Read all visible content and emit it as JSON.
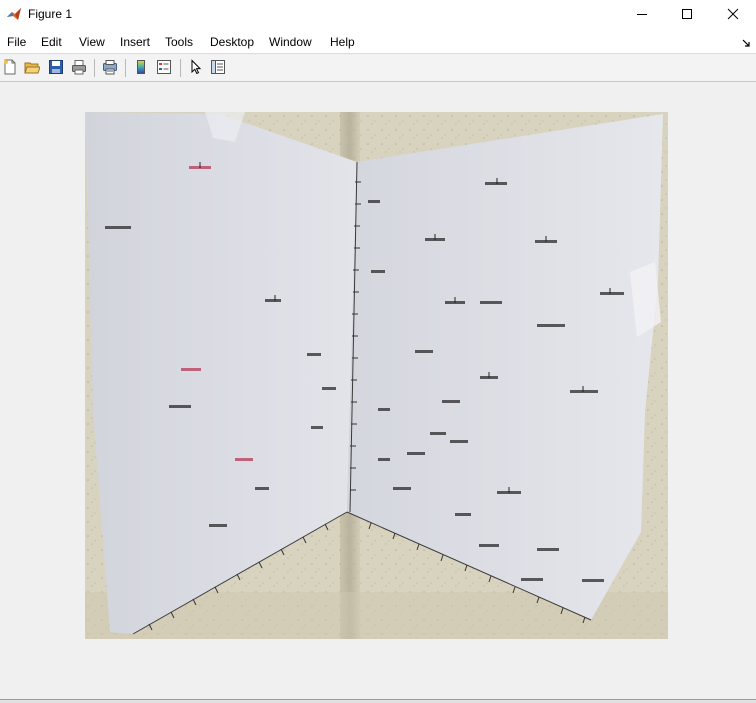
{
  "window": {
    "title": "Figure 1",
    "minimize_icon": "minimize-icon",
    "maximize_icon": "maximize-icon",
    "close_icon": "close-icon"
  },
  "menu": {
    "items": [
      "File",
      "Edit",
      "View",
      "Insert",
      "Tools",
      "Desktop",
      "Window",
      "Help"
    ]
  },
  "toolbar": {
    "icons": [
      "new-figure-icon",
      "open-file-icon",
      "save-icon",
      "print-icon",
      "print-preview-icon",
      "colorbar-icon",
      "legend-icon",
      "select-cursor-icon",
      "property-editor-icon"
    ]
  },
  "photo": {
    "description_icon": "photo-image",
    "wall_color": "#d9d4c0",
    "paper_color": "#dcdde3"
  }
}
